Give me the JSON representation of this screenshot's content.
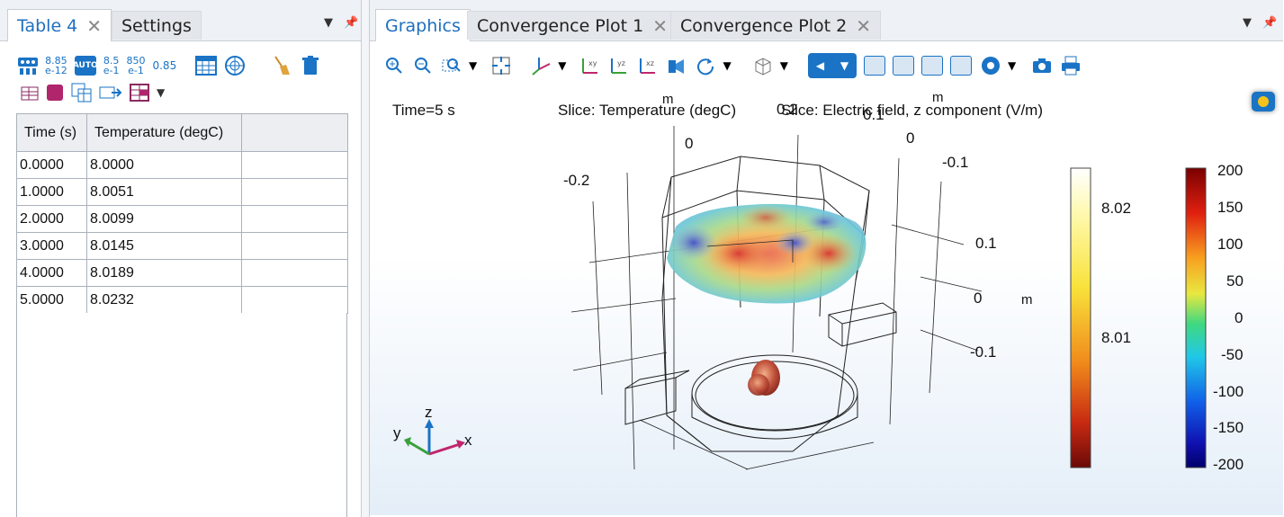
{
  "left_panel": {
    "tabs": [
      {
        "label": "Table 4",
        "active": true,
        "closable": true
      },
      {
        "label": "Settings",
        "active": false,
        "closable": false
      }
    ],
    "toolbar_numbers": {
      "fmt1_top": "8.85",
      "fmt1_bot": "e-12",
      "auto": "AUTO",
      "fmt2_top": "8.5",
      "fmt2_bot": "e-1",
      "fmt3_top": "850",
      "fmt3_bot": "e-1",
      "fmt4": "0.85"
    },
    "table": {
      "columns": [
        "Time (s)",
        "Temperature (degC)"
      ],
      "rows": [
        [
          "0.0000",
          "8.0000"
        ],
        [
          "1.0000",
          "8.0051"
        ],
        [
          "2.0000",
          "8.0099"
        ],
        [
          "3.0000",
          "8.0145"
        ],
        [
          "4.0000",
          "8.0189"
        ],
        [
          "5.0000",
          "8.0232"
        ]
      ]
    }
  },
  "right_panel": {
    "tabs": [
      {
        "label": "Graphics",
        "active": true
      },
      {
        "label": "Convergence Plot 1",
        "active": false
      },
      {
        "label": "Convergence Plot 2",
        "active": false
      }
    ],
    "graphics": {
      "time_label": "Time=5 s",
      "slice_temp_title": "Slice: Temperature (degC)",
      "slice_field_title": "Slice: Electric field, z component (V/m)",
      "axis_labels": {
        "m_top1": "m",
        "m_top2": "m",
        "m_side": "m",
        "t0_a": "0",
        "t0_b": "0",
        "tneg02": "-0.2",
        "t02": "0.2",
        "tneg01_a": "-0.1",
        "t01_a": "0.1",
        "t01_b": "0.1",
        "t0_c": "0",
        "tneg01_b": "-0.1"
      },
      "triad": {
        "x": "x",
        "y": "y",
        "z": "z"
      },
      "colorbar_temp": {
        "ticks": [
          "8.02",
          "8.01"
        ]
      },
      "colorbar_field": {
        "ticks": [
          "200",
          "150",
          "100",
          "50",
          "0",
          "-50",
          "-100",
          "-150",
          "-200"
        ]
      }
    }
  },
  "colors": {
    "accent": "#1f6fbf",
    "toolbar_blue": "#1a73c5",
    "panel_bg": "#eef1f5"
  }
}
